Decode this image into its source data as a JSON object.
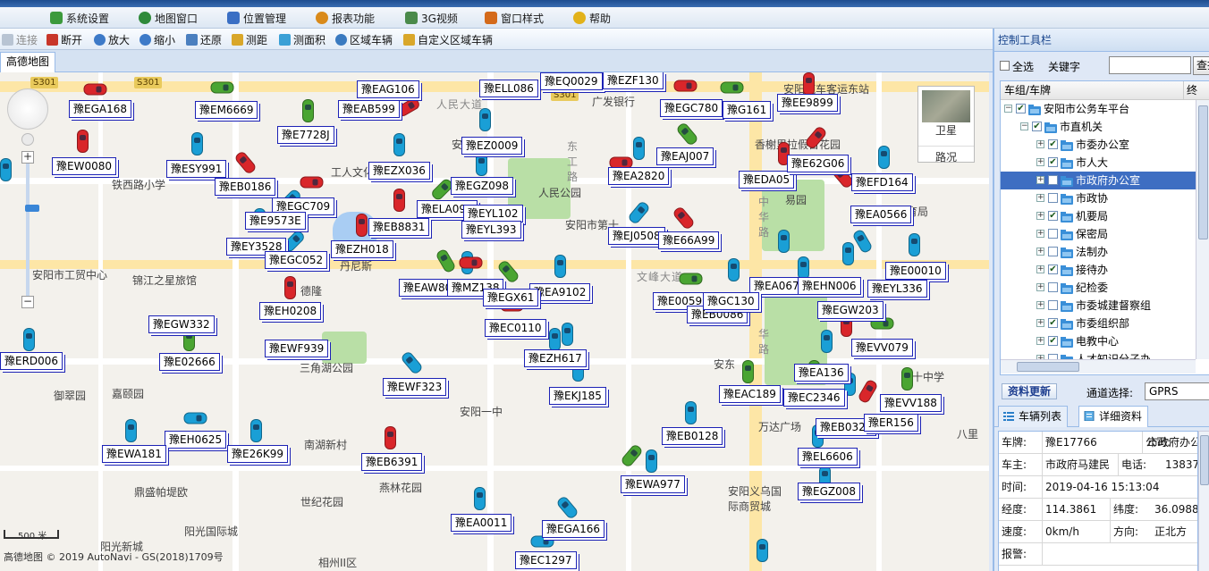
{
  "menu": {
    "items": [
      {
        "label": "系统设置",
        "icon": "settings-grid-icon",
        "color": "#3c9a3c"
      },
      {
        "label": "地图窗口",
        "icon": "globe-icon",
        "color": "#2f8a3a"
      },
      {
        "label": "位置管理",
        "icon": "list-icon",
        "color": "#3a6fc4"
      },
      {
        "label": "报表功能",
        "icon": "report-icon",
        "color": "#d98a1a"
      },
      {
        "label": "3G视频",
        "icon": "monitor-icon",
        "color": "#4a8a4a"
      },
      {
        "label": "窗口样式",
        "icon": "window-icon",
        "color": "#d46a1a"
      },
      {
        "label": "帮助",
        "icon": "star-icon",
        "color": "#e2b21a"
      }
    ]
  },
  "toolbar": {
    "items": [
      {
        "label": "连接",
        "icon": "connect-icon",
        "disabled": true
      },
      {
        "label": "断开",
        "icon": "disconnect-icon",
        "disabled": false
      },
      {
        "label": "放大",
        "icon": "zoom-in-icon",
        "disabled": false
      },
      {
        "label": "缩小",
        "icon": "zoom-out-icon",
        "disabled": false
      },
      {
        "label": "还原",
        "icon": "restore-icon",
        "disabled": false
      },
      {
        "label": "测距",
        "icon": "measure-distance-icon",
        "disabled": false
      },
      {
        "label": "测面积",
        "icon": "measure-area-icon",
        "disabled": false
      },
      {
        "label": "区域车辆",
        "icon": "area-vehicle-icon",
        "disabled": false
      },
      {
        "label": "自定义区域车辆",
        "icon": "custom-area-icon",
        "disabled": false
      }
    ]
  },
  "map_tab": {
    "label": "高德地图"
  },
  "map": {
    "layer_satellite": "卫星",
    "layer_traffic": "路况",
    "scale": "500 米",
    "copyright": "高德地图 © 2019 AutoNavi - GS(2018)1709号",
    "road_badges": [
      "S301",
      "S301",
      "S301"
    ],
    "places": [
      "铁西路小学",
      "安阳市工贸中心",
      "锦江之星旅馆",
      "御翠园",
      "嘉颐园",
      "鼎盛帕堤欧",
      "南湖新村",
      "世纪花园",
      "燕林花园",
      "阳光国际城",
      "阳光新城",
      "相州II区",
      "三角湖公园",
      "人民公园",
      "安阳市第十",
      "安阳一中",
      "广发银行",
      "安阳汽车客运东站",
      "香榭里拉假日花园",
      "易园",
      "万达广场",
      "安阳义乌国际商贸城",
      "安东",
      "文峰大道",
      "丹尼斯",
      "工人文化宫",
      "人民大道",
      "东工路",
      "中华路",
      "育局",
      "八里",
      "第十中学",
      "安阳市",
      "华路",
      "德隆"
    ],
    "vehicles": [
      "豫EGA168",
      "豫EM6669",
      "豫EAG106",
      "豫EAB599",
      "豫ELL086",
      "豫EQ0029",
      "豫EZF130",
      "豫EGC780",
      "豫E7728J",
      "豫EZ0009",
      "豫EE9899",
      "豫EW0080",
      "豫ESY991",
      "豫EZX036",
      "豫EB0186",
      "豫EGC709",
      "豫EGZ098",
      "豫EA2820",
      "豫EAJ007",
      "豫EDA05",
      "豫E62G06",
      "豫EFD164",
      "豫E9573E",
      "豫ELA098",
      "豫EYL102",
      "豫EB8831",
      "豫EYL393",
      "豫EJ0508",
      "豫E66A99",
      "豫EA0566",
      "豫EY3528",
      "豫EGC052",
      "豫EZH018",
      "豫EAW808",
      "豫MZ138",
      "豫EA9102",
      "豫EGX61",
      "豫E00599",
      "豫EA0676",
      "豫EHN006",
      "豫E00010",
      "豫EYL336",
      "豫EH0208",
      "豫EGW332",
      "豫EWF939",
      "豫EC0110",
      "豫EB0086",
      "豫EGW203",
      "豫EVV079",
      "豫ERD006",
      "豫E02666",
      "豫EZH617",
      "豫EWF323",
      "豫EKJ185",
      "豫EAC189",
      "豫EA136",
      "豫EC2346",
      "豫EVV188",
      "豫EH0625",
      "豫EWA181",
      "豫E26K99",
      "豫EB6391",
      "豫EB0128",
      "豫EB0323",
      "豫ER156",
      "豫EL6606",
      "豫EWA977",
      "豫EGZ008",
      "豫EA0011",
      "豫EGA166",
      "豫EC1297",
      "豫G161",
      "豫GC130"
    ]
  },
  "panel": {
    "title": "控制工具栏",
    "select_all": "全选",
    "keyword_label": "关键字",
    "keyword_value": "",
    "query_button": "查找",
    "tree_col1": "车组/车牌",
    "tree_col2": "终",
    "tree": [
      {
        "label": "安阳市公务车平台",
        "level": 0,
        "expand": "−",
        "checked": true,
        "selected": false
      },
      {
        "label": "市直机关",
        "level": 1,
        "expand": "−",
        "checked": true,
        "selected": false
      },
      {
        "label": "市委办公室",
        "level": 2,
        "expand": "+",
        "checked": true,
        "selected": false
      },
      {
        "label": "市人大",
        "level": 2,
        "expand": "+",
        "checked": true,
        "selected": false
      },
      {
        "label": "市政府办公室",
        "level": 2,
        "expand": "+",
        "checked": false,
        "selected": true
      },
      {
        "label": "市政协",
        "level": 2,
        "expand": "+",
        "checked": false,
        "selected": false
      },
      {
        "label": "机要局",
        "level": 2,
        "expand": "+",
        "checked": true,
        "selected": false
      },
      {
        "label": "保密局",
        "level": 2,
        "expand": "+",
        "checked": false,
        "selected": false
      },
      {
        "label": "法制办",
        "level": 2,
        "expand": "+",
        "checked": false,
        "selected": false
      },
      {
        "label": "接待办",
        "level": 2,
        "expand": "+",
        "checked": true,
        "selected": false
      },
      {
        "label": "纪检委",
        "level": 2,
        "expand": "+",
        "checked": false,
        "selected": false
      },
      {
        "label": "市委城建督察组",
        "level": 2,
        "expand": "+",
        "checked": false,
        "selected": false
      },
      {
        "label": "市委组织部",
        "level": 2,
        "expand": "+",
        "checked": true,
        "selected": false
      },
      {
        "label": "电教中心",
        "level": 2,
        "expand": "+",
        "checked": true,
        "selected": false
      },
      {
        "label": "人才知识分子办",
        "level": 2,
        "expand": "+",
        "checked": false,
        "selected": false
      }
    ],
    "refresh_button": "资料更新",
    "channel_label": "通道选择:",
    "channel_value": "GPRS",
    "tab_vehicles": "车辆列表",
    "tab_details": "详细资料",
    "details": {
      "plate_label": "车牌:",
      "plate": "豫E17766",
      "company_label": "公司:",
      "company": "市政府办公",
      "owner_label": "车主:",
      "owner": "市政府马建民",
      "phone_label": "电话:",
      "phone": "13837",
      "time_label": "时间:",
      "time": "2019-04-16 15:13:04",
      "lng_label": "经度:",
      "lng": "114.3861",
      "lat_label": "纬度:",
      "lat": "36.0988",
      "speed_label": "速度:",
      "speed": "0km/h",
      "dir_label": "方向:",
      "dir": "正北方",
      "alarm_label": "报警:",
      "alarm": ""
    }
  },
  "colors": {
    "car_blue": "#1a9fd6",
    "car_red": "#d9262a",
    "car_green": "#4aa532",
    "label_border": "#1c22b5",
    "selected_row": "#3e6ec2"
  }
}
